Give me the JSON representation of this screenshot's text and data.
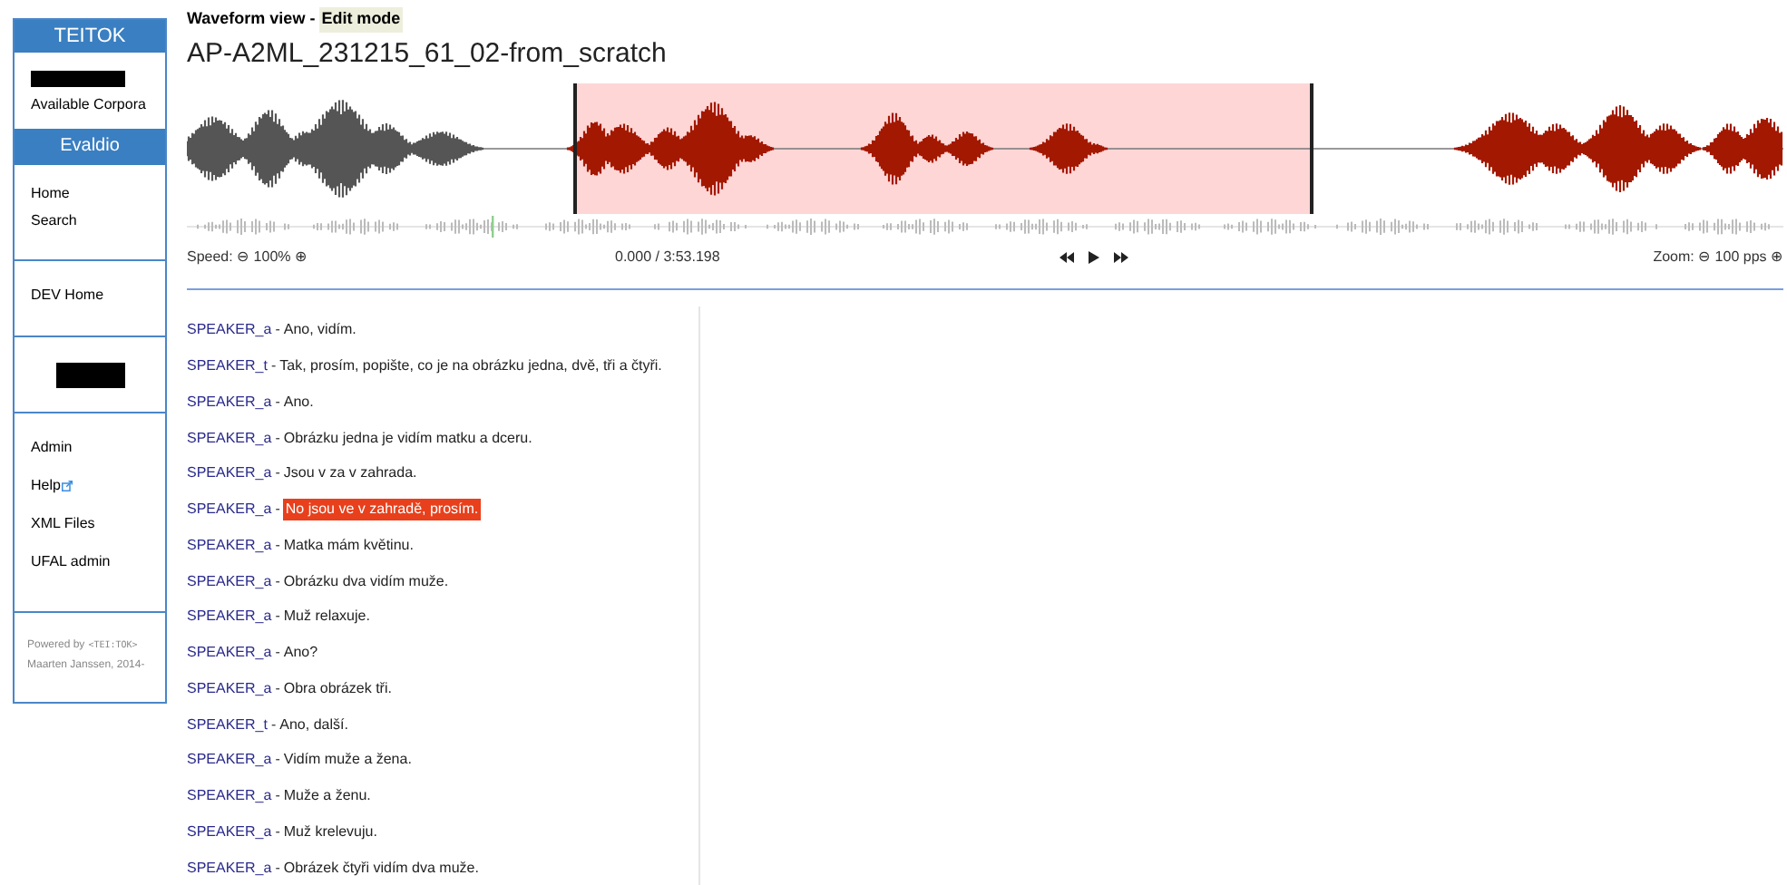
{
  "sidebar": {
    "brand": "TEITOK",
    "top_links": [
      "Available Corpora"
    ],
    "project": "Evaldio",
    "sections": [
      {
        "kind": "links",
        "items": [
          {
            "label": "Home",
            "external": false
          },
          {
            "label": "Search",
            "external": false
          }
        ]
      },
      {
        "kind": "links",
        "items": [
          {
            "label": "DEV Home",
            "external": false
          }
        ]
      },
      {
        "kind": "redacted"
      },
      {
        "kind": "links",
        "items": [
          {
            "label": "Admin",
            "external": false
          },
          {
            "label": "Help",
            "external": true
          },
          {
            "label": "XML Files",
            "external": false
          },
          {
            "label": "UFAL admin",
            "external": false
          }
        ]
      }
    ],
    "footer": {
      "powered_by": "Powered by",
      "logo": "<TEI:TOK>",
      "credit": "Maarten Janssen, 2014-"
    }
  },
  "header": {
    "view": "Waveform view - ",
    "mode": "Edit mode"
  },
  "title": "AP-A2ML_231215_61_02-from_scratch",
  "player": {
    "speed": "Speed: ⊖ 100% ⊕",
    "time": "0.000 / 3:53.198",
    "zoom": "Zoom: ⊖ 100 pps ⊕"
  },
  "utterances": [
    {
      "speaker": "SPEAKER_a",
      "separator": "-",
      "text": "Ano, vidím.",
      "selected": false
    },
    {
      "speaker": "SPEAKER_t",
      "separator": "-",
      "text": "Tak, prosím, popište, co je na obrázku jedna, dvě, tři a čtyři.",
      "selected": false
    },
    {
      "speaker": "SPEAKER_a",
      "separator": "-",
      "text": "Ano.",
      "selected": false
    },
    {
      "speaker": "SPEAKER_a",
      "separator": "-",
      "text": "Obrázku jedna je vidím matku a dceru.",
      "selected": false
    },
    {
      "speaker": "SPEAKER_a",
      "separator": "-",
      "text": "Jsou v za v zahrada.",
      "selected": false
    },
    {
      "speaker": "SPEAKER_a",
      "separator": "-",
      "text": "No jsou ve v zahradě, prosím.",
      "selected": true
    },
    {
      "speaker": "SPEAKER_a",
      "separator": "-",
      "text": "Matka mám květinu.",
      "selected": false
    },
    {
      "speaker": "SPEAKER_a",
      "separator": "-",
      "text": "Obrázku dva vidím muže.",
      "selected": false
    },
    {
      "speaker": "SPEAKER_a",
      "separator": "-",
      "text": "Muž relaxuje.",
      "selected": false
    },
    {
      "speaker": "SPEAKER_a",
      "separator": "-",
      "text": "Ano?",
      "selected": false
    },
    {
      "speaker": "SPEAKER_a",
      "separator": "-",
      "text": "Obra obrázek tři.",
      "selected": false
    },
    {
      "speaker": "SPEAKER_t",
      "separator": "-",
      "text": "Ano, další.",
      "selected": false
    },
    {
      "speaker": "SPEAKER_a",
      "separator": "-",
      "text": "Vidím muže a žena.",
      "selected": false
    },
    {
      "speaker": "SPEAKER_a",
      "separator": "-",
      "text": "Muže a ženu.",
      "selected": false
    },
    {
      "speaker": "SPEAKER_a",
      "separator": "-",
      "text": "Muž krelevuju.",
      "selected": false
    },
    {
      "speaker": "SPEAKER_a",
      "separator": "-",
      "text": "Obrázek čtyři vidím dva muže.",
      "selected": false
    }
  ]
}
